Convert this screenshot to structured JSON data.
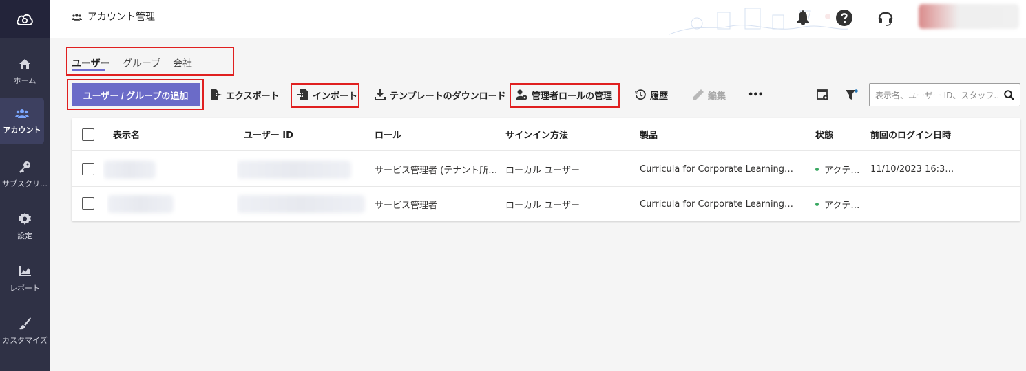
{
  "header": {
    "title": "アカウント管理"
  },
  "sidebar": {
    "items": [
      {
        "label": "ホーム",
        "icon": "home-icon"
      },
      {
        "label": "アカウント",
        "icon": "users-icon",
        "active": true
      },
      {
        "label": "サブスクリ…",
        "icon": "key-icon"
      },
      {
        "label": "設定",
        "icon": "gear-icon"
      },
      {
        "label": "レポート",
        "icon": "chart-icon"
      },
      {
        "label": "カスタマイズ",
        "icon": "brush-icon"
      }
    ]
  },
  "tabs": [
    {
      "label": "ユーザー",
      "active": true
    },
    {
      "label": "グループ"
    },
    {
      "label": "会社"
    }
  ],
  "toolbar": {
    "add_label": "ユーザー / グループの追加",
    "export_label": "エクスポート",
    "import_label": "インポート",
    "template_label": "テンプレートのダウンロード",
    "admin_role_label": "管理者ロールの管理",
    "history_label": "履歴",
    "edit_label": "編集",
    "more_label": "•••"
  },
  "search": {
    "placeholder": "表示名、ユーザー ID、スタッフ…"
  },
  "table": {
    "headers": [
      "表示名",
      "ユーザー ID",
      "ロール",
      "サインイン方法",
      "製品",
      "状態",
      "前回のログイン日時"
    ],
    "rows": [
      {
        "role": "サービス管理者 (テナント所…",
        "signin": "ローカル ユーザー",
        "product": "Curricula for Corporate Learning…",
        "status": "アクテ…",
        "last_login": "11/10/2023 16:3…"
      },
      {
        "role": "サービス管理者",
        "signin": "ローカル ユーザー",
        "product": "Curricula for Corporate Learning…",
        "status": "アクテ…",
        "last_login": ""
      }
    ]
  },
  "colors": {
    "accent": "#6b6bc8",
    "highlight_box": "#e02020",
    "sidebar_bg": "#2f3145",
    "status_active": "#3aa862"
  }
}
